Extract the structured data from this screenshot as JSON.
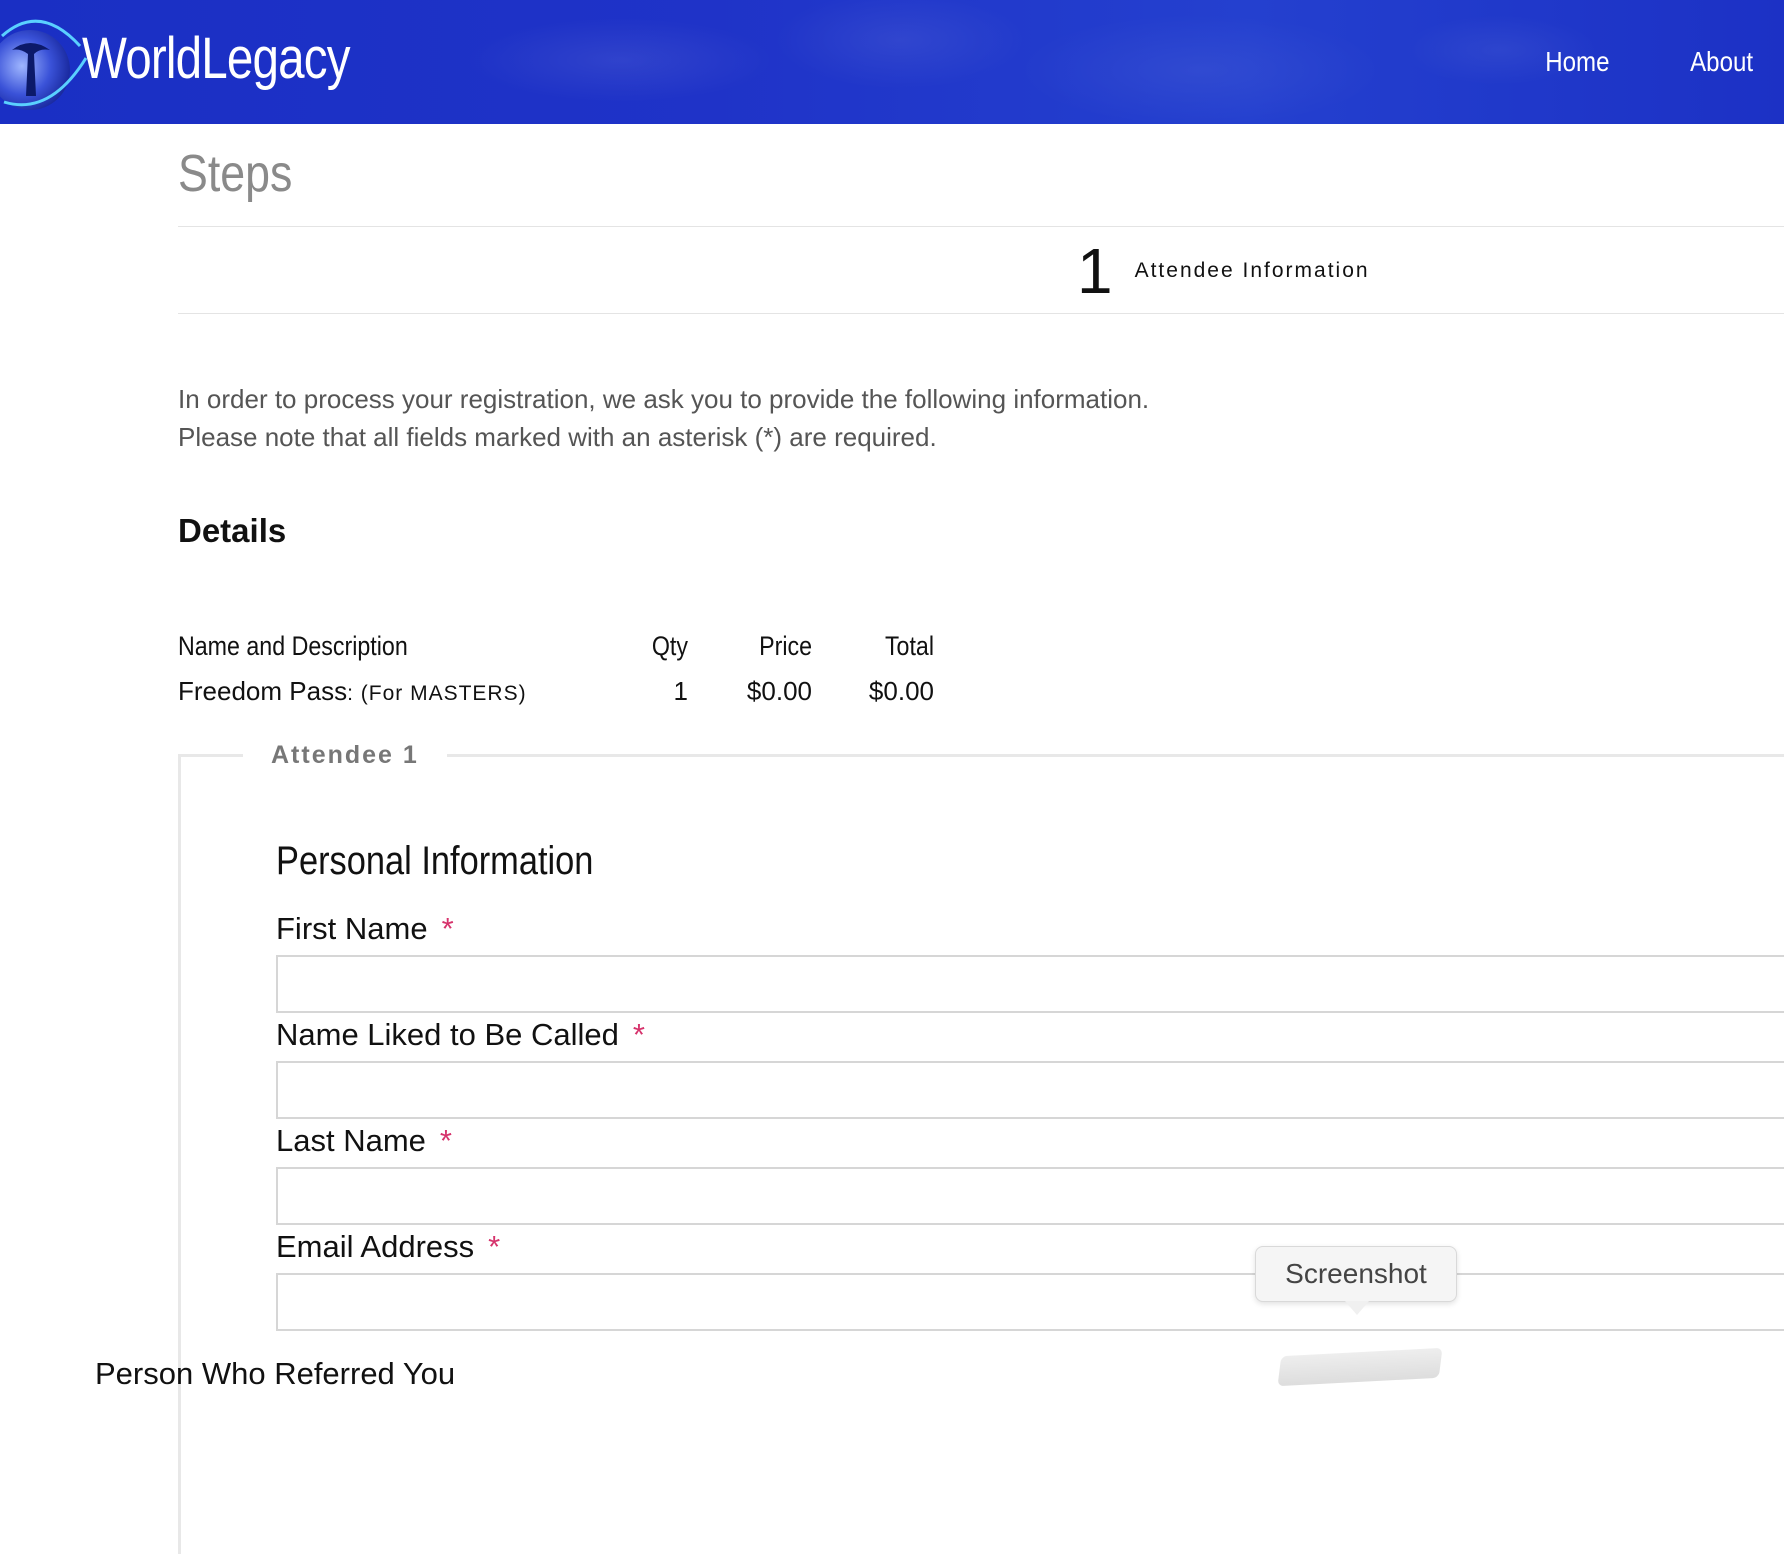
{
  "header": {
    "logo_text": "WorldLegacy",
    "nav": [
      "Home",
      "About"
    ],
    "bg_color": "#1f33c8"
  },
  "steps": {
    "title": "Steps",
    "current_number": "1",
    "current_label": "Attendee Information"
  },
  "intro": {
    "line1": "In order to process your registration, we ask you to provide the following information.",
    "line2": "Please note that all fields marked with an asterisk (*) are required."
  },
  "details": {
    "heading": "Details",
    "columns": [
      "Name and Description",
      "Qty",
      "Price",
      "Total"
    ],
    "rows": [
      {
        "name": "Freedom Pass",
        "desc": ": (For MASTERS)",
        "qty": "1",
        "price": "$0.00",
        "total": "$0.00"
      }
    ]
  },
  "attendee": {
    "legend": "Attendee 1",
    "section_title": "Personal Information",
    "fields": [
      {
        "label": "First Name",
        "required": "*"
      },
      {
        "label": "Name Liked to Be Called",
        "required": "*"
      },
      {
        "label": "Last Name",
        "required": "*"
      },
      {
        "label": "Email Address",
        "required": "*"
      }
    ],
    "next_label": "Person Who Referred You"
  },
  "tooltip": {
    "text": "Screenshot"
  }
}
